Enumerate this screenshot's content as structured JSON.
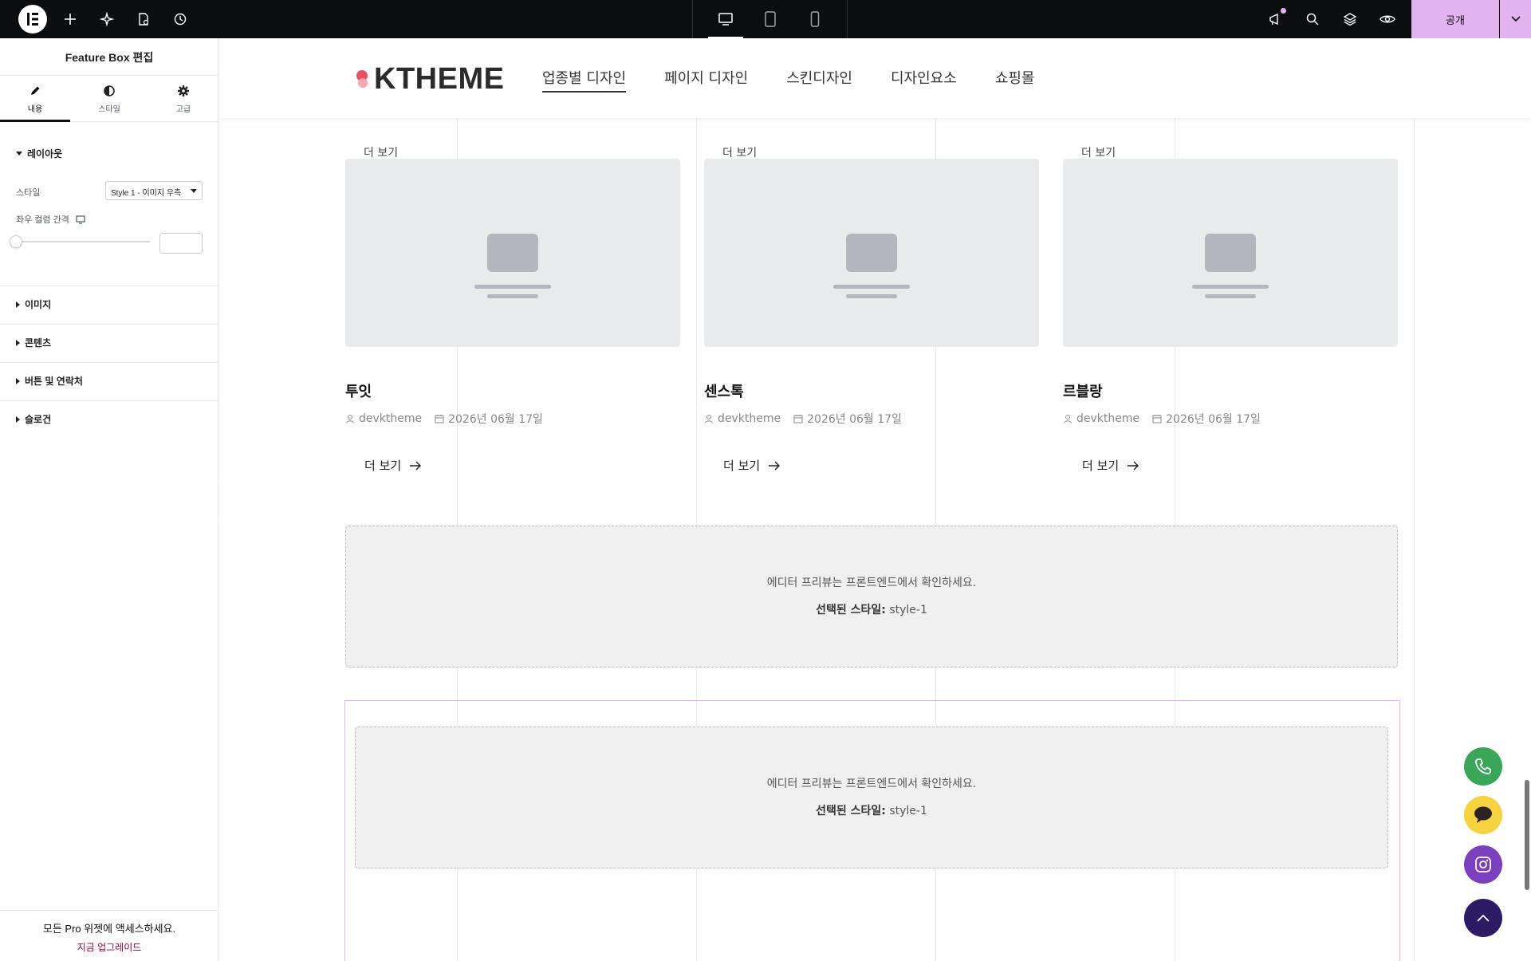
{
  "topbar": {
    "publish_label": "공개"
  },
  "panel": {
    "title": "Feature Box 편집",
    "tabs": [
      {
        "label": "내용",
        "icon": "pencil-icon"
      },
      {
        "label": "스타일",
        "icon": "contrast-icon"
      },
      {
        "label": "고급",
        "icon": "gear-icon"
      }
    ],
    "layout_section": "레이아웃",
    "style_label": "스타일",
    "style_value": "Style 1 - 이미지 우측",
    "column_gap_label": "좌우 컬럼 간격",
    "sections": [
      "이미지",
      "콘텐츠",
      "버튼 및 연락처",
      "슬로건"
    ],
    "promo_text": "모든 Pro 위젯에 액세스하세요.",
    "promo_link": "지금 업그레이드"
  },
  "site": {
    "brand": "KTHEME",
    "nav": [
      "업종별 디자인",
      "페이지 디자인",
      "스킨디자인",
      "디자인요소",
      "쇼핑몰"
    ],
    "partial_link": "더 보기",
    "cards": [
      {
        "title": "투잇",
        "author": "devktheme",
        "date": "2026년 06월 17일",
        "more": "더 보기"
      },
      {
        "title": "센스톡",
        "author": "devktheme",
        "date": "2026년 06월 17일",
        "more": "더 보기"
      },
      {
        "title": "르블랑",
        "author": "devktheme",
        "date": "2026년 06월 17일",
        "more": "더 보기"
      }
    ],
    "notices": [
      {
        "line1": "에디터 프리뷰는 프론트엔드에서 확인하세요.",
        "label": "선택된 스타일:",
        "value": "style-1"
      },
      {
        "line1": "에디터 프리뷰는 프론트엔드에서 확인하세요.",
        "label": "선택된 스타일:",
        "value": "style-1"
      }
    ]
  },
  "colors": {
    "accent": "#e1b4f0",
    "phone_fab": "#3aa657",
    "chat_fab": "#f7d33e",
    "top_fab": "#2e1b66"
  }
}
